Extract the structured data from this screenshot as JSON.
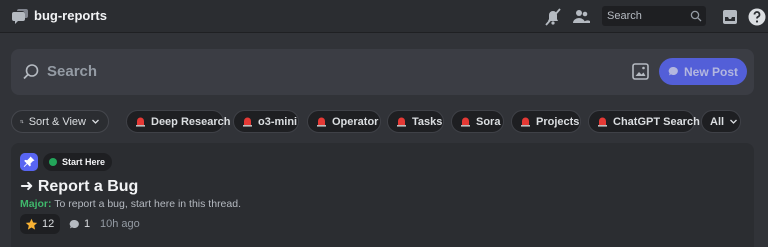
{
  "header": {
    "channel_name": "bug-reports",
    "search_placeholder": "Search"
  },
  "forum": {
    "search_placeholder": "Search",
    "new_post_label": "New Post",
    "sort_label": "Sort & View",
    "tags": [
      {
        "label": "Deep Research"
      },
      {
        "label": "o3-mini"
      },
      {
        "label": "Operator"
      },
      {
        "label": "Tasks"
      },
      {
        "label": "Sora"
      },
      {
        "label": "Projects"
      },
      {
        "label": "ChatGPT Search"
      }
    ],
    "all_label": "All"
  },
  "post": {
    "tag_label": "Start Here",
    "tag_color": "#23a55a",
    "title": "➜ Report a Bug",
    "body_prefix": "Major:",
    "body_text": " To report a bug, start here in this thread.",
    "reaction_count": "12",
    "reply_count": "1",
    "timestamp": "10h ago"
  },
  "colors": {
    "accent": "#5865f2",
    "background": "#313338",
    "major_green": "#3fb86b"
  }
}
